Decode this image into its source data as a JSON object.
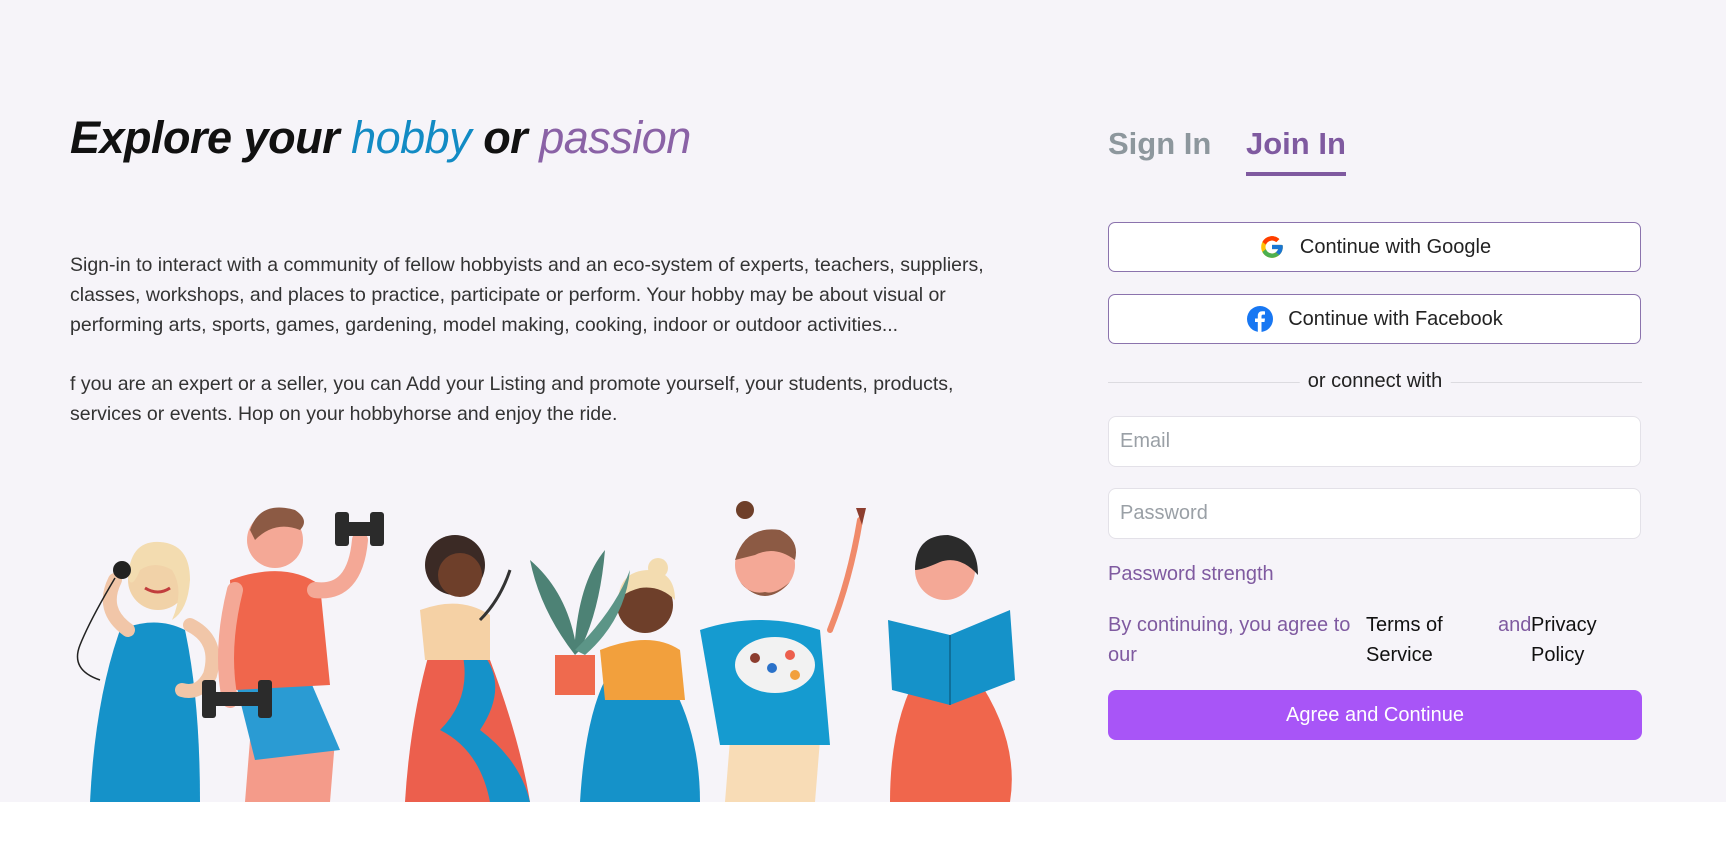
{
  "hero": {
    "headline": {
      "part1": "Explore your ",
      "hobby": "hobby",
      "part2": " or ",
      "passion": "passion"
    },
    "paragraph1": "Sign-in to interact with a community of fellow hobbyists and an eco-system of experts, teachers, suppliers, classes, workshops, and places to practice, participate or perform. Your hobby may be about visual or performing arts, sports, games, gardening, model making, cooking, indoor or outdoor activities...",
    "paragraph2": "f you are an expert or a seller, you can Add your Listing and promote yourself, your students, products, services or events. Hop on your hobbyhorse and enjoy the ride."
  },
  "auth": {
    "tabs": {
      "sign_in": "Sign In",
      "join_in": "Join In",
      "active": "join_in"
    },
    "google_label": "Continue with Google",
    "facebook_label": "Continue with Facebook",
    "divider_label": "or connect with",
    "email_placeholder": "Email",
    "password_placeholder": "Password",
    "password_strength": "Password strength",
    "terms": {
      "prefix": "By continuing, you agree to our",
      "terms_link": "Terms of Service",
      "and": "and",
      "privacy_link": "Privacy Policy"
    },
    "submit_label": "Agree and Continue"
  },
  "colors": {
    "accent_purple": "#7f5aa0",
    "hobby_blue": "#128bc4",
    "submit_button": "#a855f7",
    "page_background": "#f6f4f9"
  },
  "icons": [
    "google-icon",
    "facebook-icon"
  ]
}
